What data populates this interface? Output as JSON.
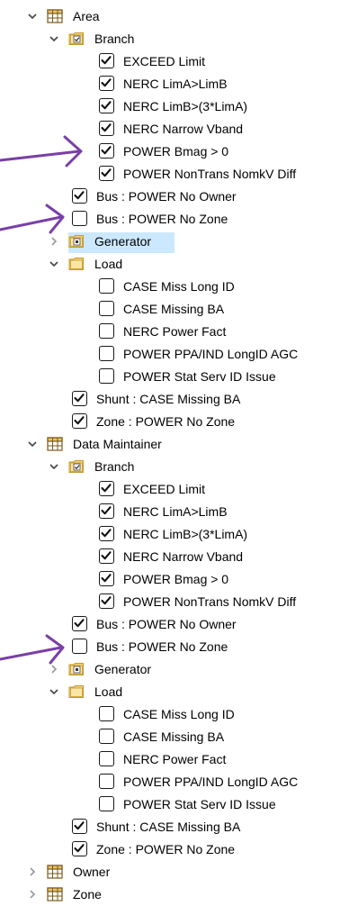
{
  "accent_color": "#7a3fa6",
  "selection_color": "#cce8ff",
  "tree": [
    {
      "level": 0,
      "type": "table-icon",
      "expand": "expanded",
      "label": "Area"
    },
    {
      "level": 1,
      "type": "folder-check-icon",
      "expand": "expanded",
      "label": "Branch"
    },
    {
      "level": 2,
      "type": "checkbox",
      "checked": true,
      "label": "EXCEED Limit"
    },
    {
      "level": 2,
      "type": "checkbox",
      "checked": true,
      "label": "NERC LimA>LimB"
    },
    {
      "level": 2,
      "type": "checkbox",
      "checked": true,
      "label": "NERC LimB>(3*LimA)"
    },
    {
      "level": 2,
      "type": "checkbox",
      "checked": true,
      "label": "NERC Narrow Vband"
    },
    {
      "level": 2,
      "type": "checkbox",
      "checked": true,
      "label": "POWER Bmag > 0"
    },
    {
      "level": 2,
      "type": "checkbox",
      "checked": true,
      "label": "POWER NonTrans NomkV Diff"
    },
    {
      "level": 1,
      "type": "checkbox",
      "checked": true,
      "label": "Bus : POWER No Owner"
    },
    {
      "level": 1,
      "type": "checkbox",
      "checked": false,
      "label": "Bus : POWER No Zone"
    },
    {
      "level": 1,
      "type": "folder-dot-icon",
      "expand": "collapsed",
      "label": "Generator"
    },
    {
      "level": 1,
      "type": "folder-empty-icon",
      "expand": "expanded",
      "label": "Load"
    },
    {
      "level": 2,
      "type": "checkbox",
      "checked": false,
      "label": "CASE Miss Long ID"
    },
    {
      "level": 2,
      "type": "checkbox",
      "checked": false,
      "label": "CASE Missing BA"
    },
    {
      "level": 2,
      "type": "checkbox",
      "checked": false,
      "label": "NERC Power Fact"
    },
    {
      "level": 2,
      "type": "checkbox",
      "checked": false,
      "label": "POWER PPA/IND LongID AGC"
    },
    {
      "level": 2,
      "type": "checkbox",
      "checked": false,
      "label": "POWER Stat Serv ID Issue"
    },
    {
      "level": 1,
      "type": "checkbox",
      "checked": true,
      "label": "Shunt : CASE Missing BA"
    },
    {
      "level": 1,
      "type": "checkbox",
      "checked": true,
      "label": "Zone : POWER No Zone"
    },
    {
      "level": 0,
      "type": "table-icon",
      "expand": "expanded",
      "label": "Data Maintainer"
    },
    {
      "level": 1,
      "type": "folder-check-icon",
      "expand": "expanded",
      "label": "Branch"
    },
    {
      "level": 2,
      "type": "checkbox",
      "checked": true,
      "label": "EXCEED Limit"
    },
    {
      "level": 2,
      "type": "checkbox",
      "checked": true,
      "label": "NERC LimA>LimB"
    },
    {
      "level": 2,
      "type": "checkbox",
      "checked": true,
      "label": "NERC LimB>(3*LimA)"
    },
    {
      "level": 2,
      "type": "checkbox",
      "checked": true,
      "label": "NERC Narrow Vband"
    },
    {
      "level": 2,
      "type": "checkbox",
      "checked": true,
      "label": "POWER Bmag > 0"
    },
    {
      "level": 2,
      "type": "checkbox",
      "checked": true,
      "label": "POWER NonTrans NomkV Diff"
    },
    {
      "level": 1,
      "type": "checkbox",
      "checked": true,
      "label": "Bus : POWER No Owner"
    },
    {
      "level": 1,
      "type": "checkbox",
      "checked": false,
      "label": "Bus : POWER No Zone"
    },
    {
      "level": 1,
      "type": "folder-dot-icon",
      "expand": "collapsed",
      "label": "Generator"
    },
    {
      "level": 1,
      "type": "folder-empty-icon",
      "expand": "expanded",
      "label": "Load"
    },
    {
      "level": 2,
      "type": "checkbox",
      "checked": false,
      "label": "CASE Miss Long ID"
    },
    {
      "level": 2,
      "type": "checkbox",
      "checked": false,
      "label": "CASE Missing BA"
    },
    {
      "level": 2,
      "type": "checkbox",
      "checked": false,
      "label": "NERC Power Fact"
    },
    {
      "level": 2,
      "type": "checkbox",
      "checked": false,
      "label": "POWER PPA/IND LongID AGC"
    },
    {
      "level": 2,
      "type": "checkbox",
      "checked": false,
      "label": "POWER Stat Serv ID Issue"
    },
    {
      "level": 1,
      "type": "checkbox",
      "checked": true,
      "label": "Shunt : CASE Missing BA"
    },
    {
      "level": 1,
      "type": "checkbox",
      "checked": true,
      "label": "Zone : POWER No Zone"
    },
    {
      "level": 0,
      "type": "table-icon",
      "expand": "collapsed",
      "label": "Owner"
    },
    {
      "level": 0,
      "type": "table-icon",
      "expand": "collapsed",
      "label": "Zone"
    }
  ]
}
